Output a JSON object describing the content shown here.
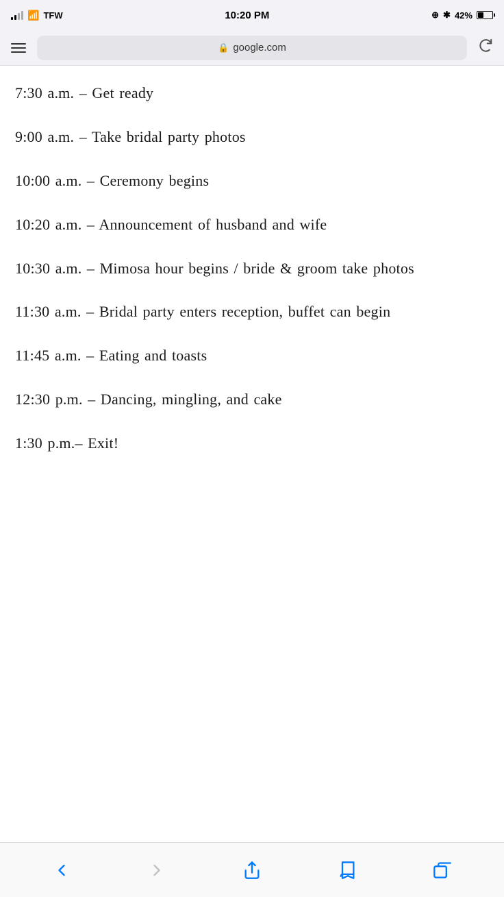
{
  "statusBar": {
    "carrier": "TFW",
    "time": "10:20 PM",
    "battery": "42%"
  },
  "addressBar": {
    "url": "google.com",
    "lockLabel": "🔒"
  },
  "schedule": {
    "items": [
      {
        "id": 1,
        "text": "7:30 a.m. – Get ready"
      },
      {
        "id": 2,
        "text": "9:00 a.m. – Take bridal party photos"
      },
      {
        "id": 3,
        "text": "10:00 a.m. – Ceremony begins"
      },
      {
        "id": 4,
        "text": "10:20 a.m. – Announcement of husband and wife"
      },
      {
        "id": 5,
        "text": "10:30 a.m. – Mimosa hour begins / bride & groom take photos"
      },
      {
        "id": 6,
        "text": "11:30 a.m. – Bridal party enters reception, buffet can begin"
      },
      {
        "id": 7,
        "text": "11:45 a.m. – Eating and toasts"
      },
      {
        "id": 8,
        "text": "12:30 p.m. – Dancing, mingling, and cake"
      },
      {
        "id": 9,
        "text": "1:30 p.m.– Exit!"
      }
    ]
  },
  "nav": {
    "back_label": "‹",
    "forward_label": "›"
  }
}
